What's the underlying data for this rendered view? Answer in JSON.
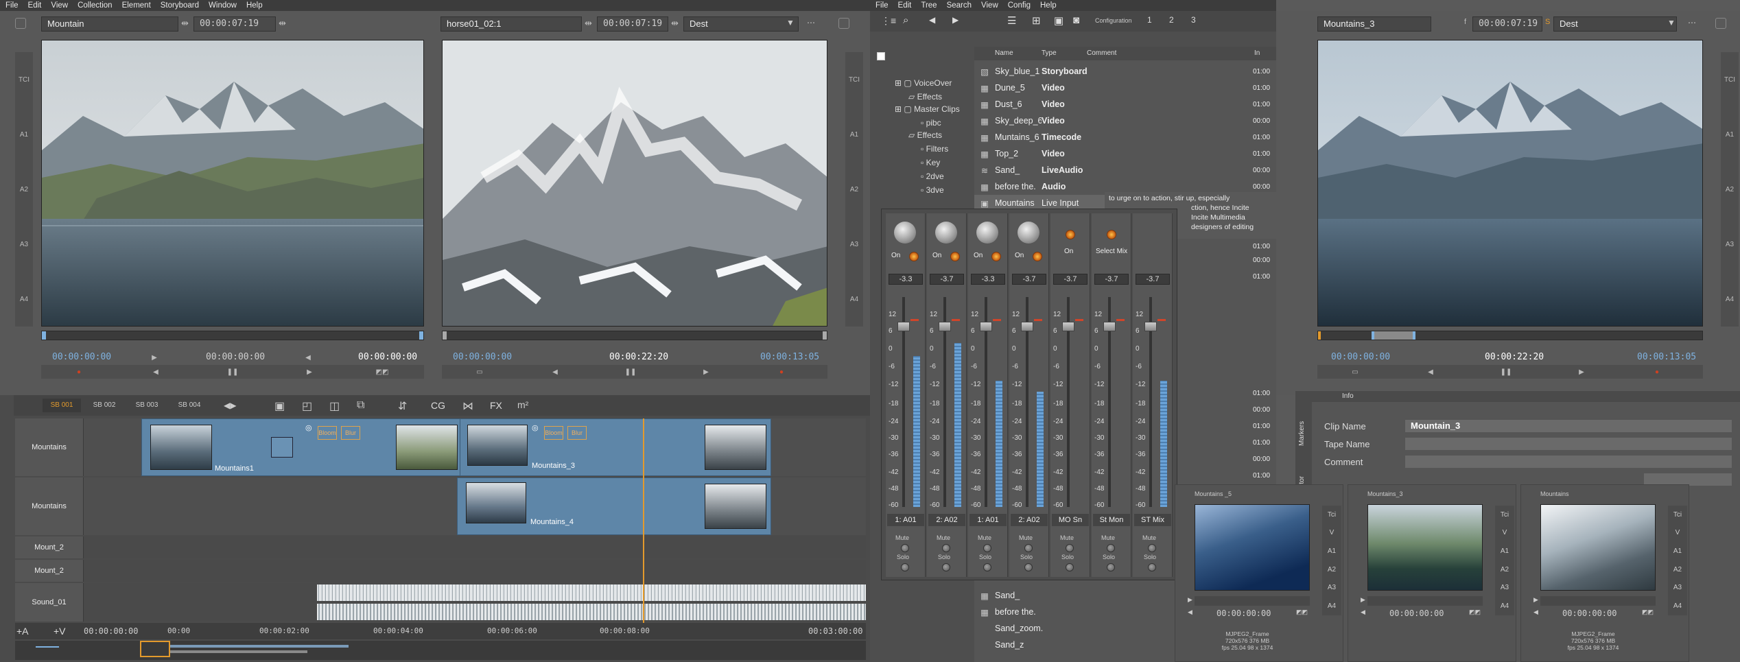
{
  "menu_left": [
    "File",
    "Edit",
    "View",
    "Collection",
    "Element",
    "Storyboard",
    "Window",
    "Help"
  ],
  "menu_mid": [
    "File",
    "Edit",
    "Tree",
    "Search",
    "View",
    "Config",
    "Help"
  ],
  "source_viewer": {
    "clip_name": "Mountain",
    "timecode": "00:00:07:19",
    "tc_in": "00:00:00:00",
    "tc_mid": "00:00:00:00",
    "tc_out": "00:00:00:00"
  },
  "record_viewer": {
    "clip_name": "horse01_02:1",
    "timecode": "00:00:07:19",
    "dest": "Dest",
    "tc_in": "00:00:00:00",
    "tc_mid": "00:00:22:20",
    "tc_out": "00:00:13:05"
  },
  "right_viewer": {
    "clip_name": "Mountains_3",
    "timecode": "00:00:07:19",
    "dest": "Dest",
    "tc_in": "00:00:00:00",
    "tc_mid": "00:00:22:20",
    "tc_out": "00:00:13:05"
  },
  "track_side_labels": [
    "TCI",
    "A1",
    "A2",
    "A3",
    "A4"
  ],
  "sb_tabs": [
    "SB 001",
    "SB 002",
    "SB 003",
    "SB 004"
  ],
  "timeline_tools": [
    "CG",
    "FX"
  ],
  "tracks": [
    {
      "name": "Mountains"
    },
    {
      "name": "Mountains"
    },
    {
      "name": "Mount_2"
    },
    {
      "name": "Mount_2"
    },
    {
      "name": "Sound_01"
    }
  ],
  "clips": {
    "mountains1": "Mountains1",
    "mountains3": "Mountains_3",
    "mountains4": "Mountains_4",
    "fx_a": "Bloom",
    "fx_b": "Blur",
    "fx_c": "Bloom",
    "fx_d": "Blur"
  },
  "ruler": [
    "00:00:00:00",
    "00:00",
    "00:00:02:00",
    "00:00:04:00",
    "00:00:06:00",
    "00:00:08:00",
    "00:03:00:00"
  ],
  "add_buttons": [
    "+A",
    "+V"
  ],
  "browser_toolbar": {
    "config_label": "Configuration",
    "config_pages": [
      "1",
      "2",
      "3"
    ]
  },
  "tree": [
    "VoiceOver",
    "Effects",
    "Master Clips",
    "pibc",
    "Effects",
    "Filters",
    "Key",
    "2dve",
    "3dve"
  ],
  "browser_cols": [
    "Name",
    "Type",
    "Comment",
    "In"
  ],
  "browser_rows": [
    {
      "name": "Sky_blue_1",
      "type": "Storyboard",
      "in": "01:00"
    },
    {
      "name": "Dune_5",
      "type": "Video",
      "in": "01:00"
    },
    {
      "name": "Dust_6",
      "type": "Video",
      "in": "01:00"
    },
    {
      "name": "Sky_deep_6",
      "type": "Video",
      "in": "00:00"
    },
    {
      "name": "Muntains_6",
      "type": "Timecode",
      "in": "01:00"
    },
    {
      "name": "Top_2",
      "type": "Video",
      "in": "01:00"
    },
    {
      "name": "Sand_",
      "type": "LiveAudio",
      "in": "00:00"
    },
    {
      "name": "before the.",
      "type": "Audio",
      "in": "00:00"
    },
    {
      "name": "Mountains",
      "type": "Live Input",
      "in": "01:00"
    }
  ],
  "comment_text": [
    "to urge on to action, stir up, especially",
    "ction, hence Incite",
    "Incite Multimedia",
    "designers of editing"
  ],
  "extra_in": [
    "01:00",
    "00:00",
    "01:00",
    "01:00",
    "00:00",
    "01:00",
    "01:00",
    "00:00",
    "01:00",
    "01:00"
  ],
  "browser_bottom": [
    "Sand_",
    "before the.",
    "Sand_zoom.",
    "Sand_z"
  ],
  "mixer": {
    "strips": [
      {
        "on": "On",
        "value": "-3.3",
        "route": "1: A01",
        "fill": 0.72
      },
      {
        "on": "On",
        "value": "-3.7",
        "route": "2: A02",
        "fill": 0.78
      },
      {
        "on": "On",
        "value": "-3.3",
        "route": "1: A01",
        "fill": 0.6
      },
      {
        "on": "On",
        "value": "-3.7",
        "route": "2: A02",
        "fill": 0.55
      },
      {
        "on": "On",
        "value": "-3.7",
        "route": "MO Sn",
        "fill": 0
      },
      {
        "on": "Select Mix",
        "value": "-3.7",
        "route": "St Mon",
        "fill": 0
      },
      {
        "on": "",
        "value": "-3.7",
        "route": "ST Mix",
        "fill": 0.6
      }
    ],
    "scale": [
      "12",
      "6",
      "0",
      "-6",
      "-12",
      "-18",
      "-24",
      "-30",
      "-36",
      "-42",
      "-48",
      "-60"
    ],
    "mute_label": "Mute",
    "solo_label": "Solo"
  },
  "info": {
    "title": "Info",
    "rows": [
      {
        "label": "Clip Name",
        "value": "Mountain_3"
      },
      {
        "label": "Tape Name",
        "value": ""
      },
      {
        "label": "Comment",
        "value": ""
      }
    ],
    "side_tabs": [
      "Markers",
      "Editor"
    ]
  },
  "bins": [
    {
      "title": "Mountains _5",
      "tc": "00:00:00:00",
      "meta1": "MJPEG2_Frame",
      "meta2": "720x576 376 MB",
      "meta3": "fps 25.04 98 x 1374"
    },
    {
      "title": "Mountains_3",
      "tc": "00:00:00:00",
      "meta1": "",
      "meta2": "",
      "meta3": ""
    },
    {
      "title": "Mountains",
      "tc": "00:00:00:00",
      "meta1": "MJPEG2_Frame",
      "meta2": "720x576 376 MB",
      "meta3": "fps 25.04 98 x 1374"
    }
  ],
  "bin_side_labels": [
    "Tci",
    "V",
    "A1",
    "A2",
    "A3",
    "A4"
  ],
  "colors": {
    "accent": "#e39a2c",
    "timecode": "#7fb2e0",
    "clip": "#5e86a8"
  }
}
